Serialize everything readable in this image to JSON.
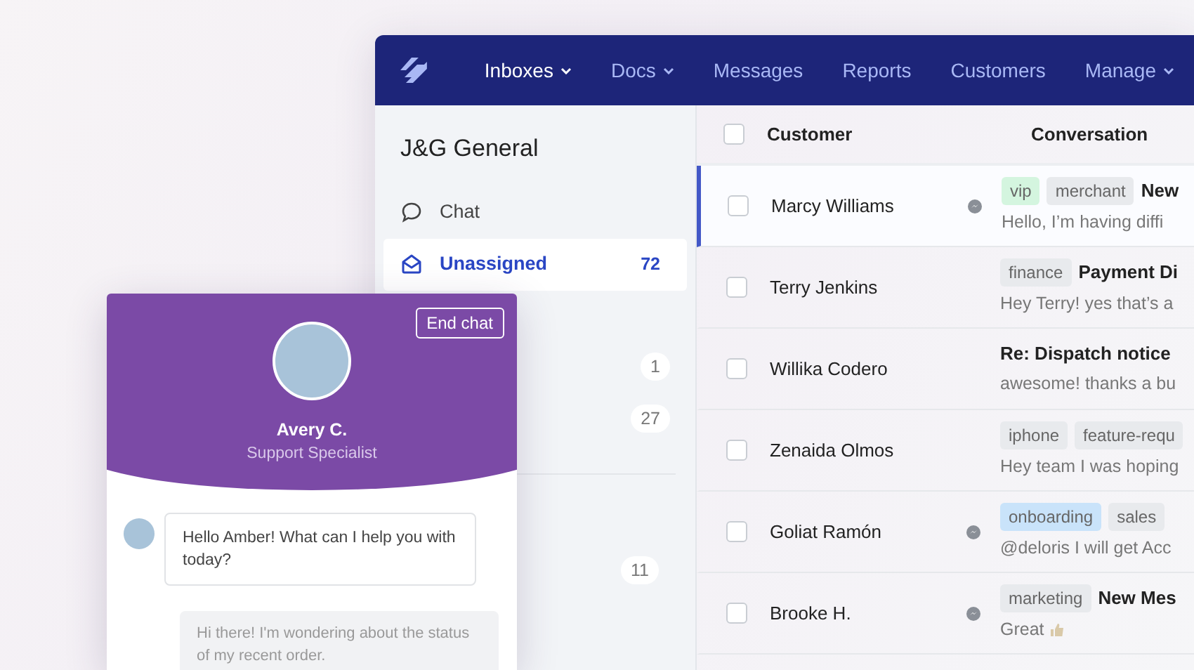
{
  "app": {
    "nav": [
      {
        "label": "Inboxes",
        "caret": true,
        "selected": true
      },
      {
        "label": "Docs",
        "caret": true,
        "selected": false
      },
      {
        "label": "Messages",
        "caret": false,
        "selected": false
      },
      {
        "label": "Reports",
        "caret": false,
        "selected": false
      },
      {
        "label": "Customers",
        "caret": false,
        "selected": false
      },
      {
        "label": "Manage",
        "caret": true,
        "selected": false
      }
    ],
    "sidebar": {
      "title": "J&G General",
      "groups": [
        {
          "items": [
            {
              "kind": "chat",
              "label": "Chat",
              "selected": false
            },
            {
              "kind": "inbox",
              "label": "Unassigned",
              "count": "72",
              "selected": true
            },
            {
              "kind": "hidden",
              "count": "1",
              "selected": false
            },
            {
              "kind": "hidden",
              "count": "27",
              "selected": false
            }
          ]
        },
        {
          "items": [
            {
              "kind": "hidden",
              "count": "11",
              "selected": false
            }
          ]
        }
      ]
    },
    "table": {
      "header": {
        "checked": false,
        "columns": [
          "Customer",
          "Conversation"
        ]
      },
      "rows": [
        {
          "customer": "Marcy Williams",
          "checked": false,
          "selected": true,
          "messenger": true,
          "tags": [
            {
              "label": "vip",
              "color": "#d4f5df"
            },
            {
              "label": "merchant",
              "color": "#e8eaed"
            }
          ],
          "subject": "New",
          "preview": "Hello, I’m having diffi"
        },
        {
          "customer": "Terry Jenkins",
          "checked": false,
          "selected": false,
          "messenger": false,
          "tags": [
            {
              "label": "finance",
              "color": "#e8eaed"
            }
          ],
          "subject": "Payment Di",
          "preview": "Hey Terry! yes that’s a"
        },
        {
          "customer": "Willika Codero",
          "checked": false,
          "selected": false,
          "messenger": false,
          "tags": [],
          "subject": "Re: Dispatch notice",
          "preview": "awesome! thanks a bu"
        },
        {
          "customer": "Zenaida Olmos",
          "checked": false,
          "selected": false,
          "messenger": false,
          "tags": [
            {
              "label": "iphone",
              "color": "#e8eaed"
            },
            {
              "label": "feature-requ",
              "color": "#e8eaed"
            }
          ],
          "preview": "Hey team I was hoping"
        },
        {
          "customer": "Goliat Ramón",
          "checked": false,
          "selected": false,
          "messenger": true,
          "tags": [
            {
              "label": "onboarding",
              "color": "#c9e3fa"
            },
            {
              "label": "sales",
              "color": "#e8eaed"
            }
          ],
          "preview": "@deloris I will get Acc"
        },
        {
          "customer": "Brooke H.",
          "checked": false,
          "selected": false,
          "messenger": true,
          "tags": [
            {
              "label": "marketing",
              "color": "#e8eaed"
            }
          ],
          "subject": "New Mes",
          "preview": "Great",
          "thumbs_up": true
        }
      ]
    }
  },
  "chat": {
    "end_button": "End chat",
    "agent_name": "Avery C.",
    "agent_role": "Support Specialist",
    "messages": [
      {
        "kind": "agent",
        "text": "Hello Amber! What can I help you with today?"
      },
      {
        "kind": "customer",
        "text": "Hi there! I'm wondering about the status of my recent order."
      }
    ]
  }
}
